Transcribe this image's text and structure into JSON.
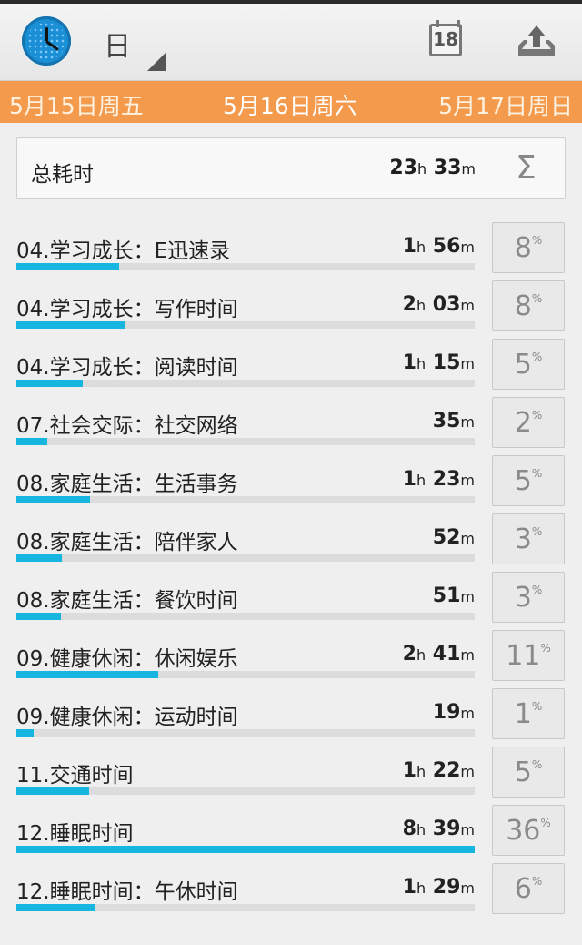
{
  "toolbar": {
    "view_label": "日",
    "calendar_day": "18"
  },
  "datebar": {
    "prev": "5月15日周五",
    "current": "5月16日周六",
    "next": "5月17日周日"
  },
  "total": {
    "label": "总耗时",
    "hours": "23",
    "minutes": "33",
    "sigma": "Σ"
  },
  "units": {
    "h": "h",
    "m": "m",
    "pct": "%"
  },
  "rows": [
    {
      "name": "04.学习成长：E迅速录",
      "hours": "1",
      "minutes": "56",
      "percent": "8",
      "bar_fraction": 0.224
    },
    {
      "name": "04.学习成长：写作时间",
      "hours": "2",
      "minutes": "03",
      "percent": "8",
      "bar_fraction": 0.237
    },
    {
      "name": "04.学习成长：阅读时间",
      "hours": "1",
      "minutes": "15",
      "percent": "5",
      "bar_fraction": 0.145
    },
    {
      "name": "07.社会交际：社交网络",
      "hours": "",
      "minutes": "35",
      "percent": "2",
      "bar_fraction": 0.068
    },
    {
      "name": "08.家庭生活：生活事务",
      "hours": "1",
      "minutes": "23",
      "percent": "5",
      "bar_fraction": 0.16
    },
    {
      "name": "08.家庭生活：陪伴家人",
      "hours": "",
      "minutes": "52",
      "percent": "3",
      "bar_fraction": 0.1
    },
    {
      "name": "08.家庭生活：餐饮时间",
      "hours": "",
      "minutes": "51",
      "percent": "3",
      "bar_fraction": 0.098
    },
    {
      "name": "09.健康休闲：休闲娱乐",
      "hours": "2",
      "minutes": "41",
      "percent": "11",
      "bar_fraction": 0.31
    },
    {
      "name": "09.健康休闲：运动时间",
      "hours": "",
      "minutes": "19",
      "percent": "1",
      "bar_fraction": 0.037
    },
    {
      "name": "11.交通时间",
      "hours": "1",
      "minutes": "22",
      "percent": "5",
      "bar_fraction": 0.158
    },
    {
      "name": "12.睡眠时间",
      "hours": "8",
      "minutes": "39",
      "percent": "36",
      "bar_fraction": 1.0
    },
    {
      "name": "12.睡眠时间：午休时间",
      "hours": "1",
      "minutes": "29",
      "percent": "6",
      "bar_fraction": 0.172
    }
  ],
  "colors": {
    "datebar_bg": "#f39a4d",
    "bar_fill": "#17b6e0",
    "bar_track": "#dcdcdc",
    "app_icon": "#1b8fd6"
  }
}
